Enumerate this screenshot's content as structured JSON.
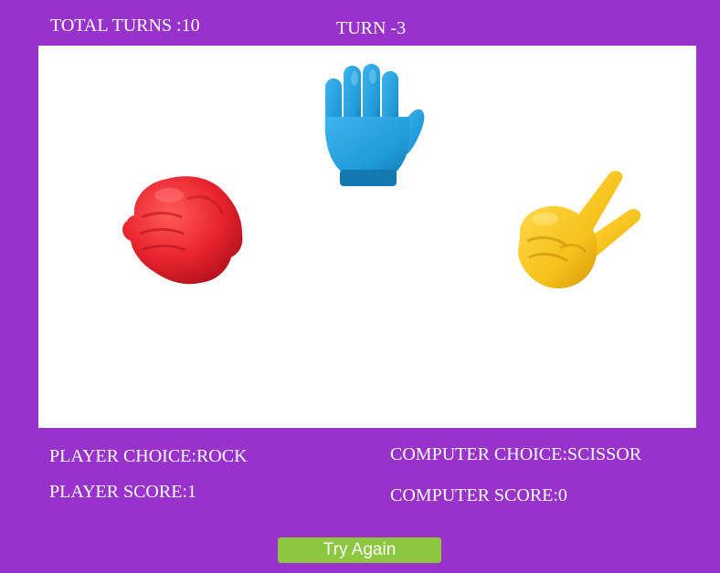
{
  "header": {
    "total_turns": "TOTAL TURNS :10",
    "turn": "TURN -3"
  },
  "board": {
    "options": [
      {
        "name": "rock",
        "icon": "rock-fist-icon",
        "color": "#e8242e"
      },
      {
        "name": "paper",
        "icon": "paper-hand-icon",
        "color": "#1f9ad8"
      },
      {
        "name": "scissor",
        "icon": "scissor-hand-icon",
        "color": "#f6c21b"
      }
    ]
  },
  "results": {
    "player_choice": "PLAYER CHOICE:ROCK",
    "player_score": "PLAYER SCORE:1",
    "computer_choice": "COMPUTER CHOICE:SCISSOR",
    "computer_score": "COMPUTER SCORE:0"
  },
  "actions": {
    "try_again_label": "Try Again"
  },
  "colors": {
    "background": "#9932cc",
    "board": "#ffffff",
    "button": "#8dc63f",
    "text": "#ffffff"
  }
}
